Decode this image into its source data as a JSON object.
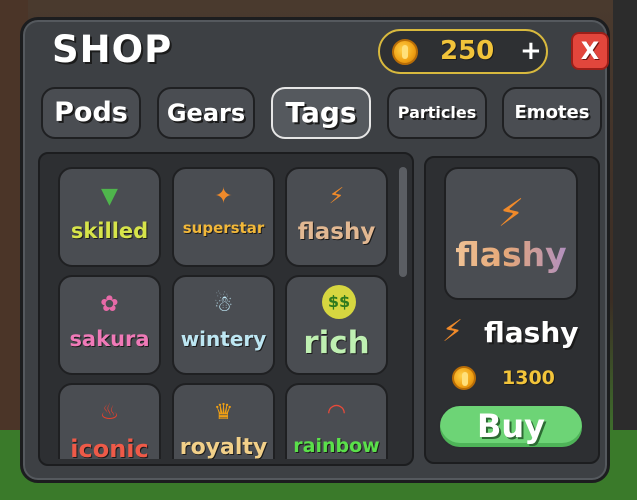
{
  "shop": {
    "title": "SHOP",
    "currency": {
      "icon": "coin-icon",
      "amount": "250",
      "add_label": "+"
    },
    "close_label": "X",
    "tabs": [
      {
        "label": "Pods",
        "active": false
      },
      {
        "label": "Gears",
        "active": false
      },
      {
        "label": "Tags",
        "active": true
      },
      {
        "label": "Particles",
        "active": false
      },
      {
        "label": "Emotes",
        "active": false
      }
    ],
    "items": [
      {
        "name": "skilled",
        "icon": "beginner-leaf-icon",
        "glyph": "⏷"
      },
      {
        "name": "superstar",
        "icon": "sparkle-icon",
        "glyph": "✦"
      },
      {
        "name": "flashy",
        "icon": "lightning-icon",
        "glyph": "⚡"
      },
      {
        "name": "sakura",
        "icon": "flower-icon",
        "glyph": "✿"
      },
      {
        "name": "wintery",
        "icon": "snowman-icon",
        "glyph": "☃"
      },
      {
        "name": "rich",
        "icon": "money-face-icon",
        "glyph": "$$"
      },
      {
        "name": "iconic",
        "icon": "fire-icon",
        "glyph": "♨"
      },
      {
        "name": "royalty",
        "icon": "crown-icon",
        "glyph": "♛"
      },
      {
        "name": "rainbow",
        "icon": "rainbow-icon",
        "glyph": "◠"
      }
    ],
    "selected": {
      "name": "flashy",
      "icon": "lightning-icon",
      "price": "1300",
      "buy_label": "Buy"
    }
  },
  "colors": {
    "panel": "#3d4044",
    "accent_gold": "#f2c43a",
    "close_red": "#e2463c",
    "buy_green": "#6dd476"
  }
}
